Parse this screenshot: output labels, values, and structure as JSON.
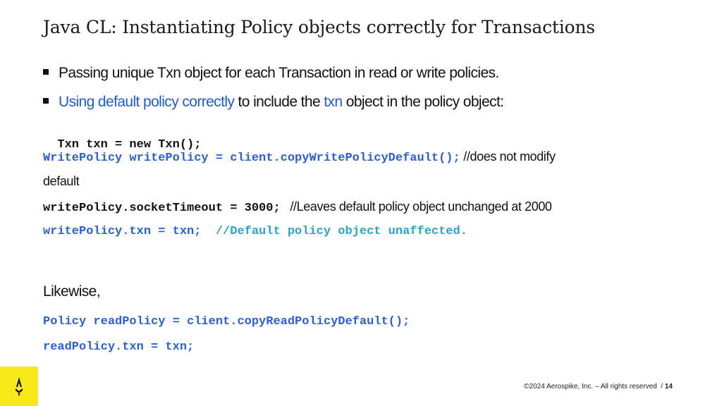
{
  "slide": {
    "title": "Java CL: Instantiating Policy objects correctly for Transactions",
    "bullets": {
      "b1": "Passing unique Txn object for each Transaction in read or write policies.",
      "b2_link": "Using default policy correctly",
      "b2_mid": " to include the ",
      "b2_txn": "txn",
      "b2_end": " object in the policy object:"
    },
    "code": {
      "line1": "Txn txn = new Txn();",
      "line2": "WritePolicy writePolicy = client.copyWritePolicyDefault();",
      "line2_comment": " //does not modify",
      "line2_cont": "default",
      "line3": "writePolicy.socketTimeout = 3000;",
      "line3_comment": "   //Leaves default policy object unchanged at 2000",
      "line4": "writePolicy.txn = txn;",
      "line4_comment": "  //Default policy object unaffected.",
      "likewise": "Likewise,",
      "line5": "Policy readPolicy = client.copyReadPolicyDefault();",
      "line6": "readPolicy.txn = txn;"
    },
    "footer": {
      "copyright": "©2024 Aerospike, Inc. – All rights reserved",
      "sep": "  / ",
      "page": "14"
    },
    "colors": {
      "accent_blue": "#1f5bd6",
      "code_blue": "#2b61d1",
      "comment_cyan": "#2ea3c6",
      "logo_yellow": "#f6e81b"
    },
    "icons": {
      "logo": "aerospike-logo-icon"
    }
  }
}
